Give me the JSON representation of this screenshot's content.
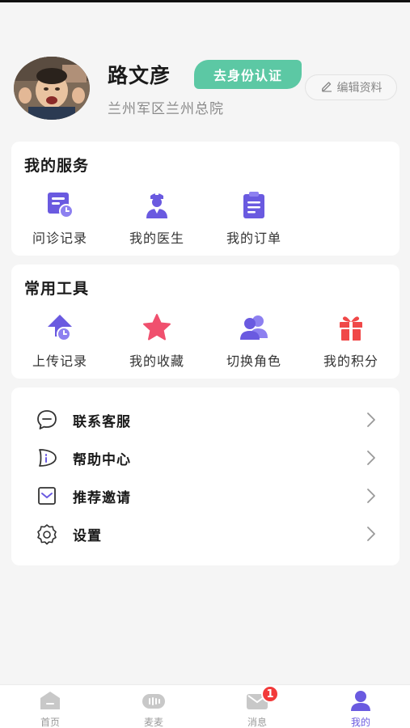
{
  "profile": {
    "name": "路文彦",
    "verify_label": "去身份认证",
    "edit_label": "编辑资料",
    "hospital": "兰州军区兰州总院"
  },
  "services": {
    "title": "我的服务",
    "items": [
      {
        "label": "问诊记录",
        "icon": "consult-record-icon"
      },
      {
        "label": "我的医生",
        "icon": "doctor-icon"
      },
      {
        "label": "我的订单",
        "icon": "order-clipboard-icon"
      }
    ]
  },
  "tools": {
    "title": "常用工具",
    "items": [
      {
        "label": "上传记录",
        "icon": "upload-icon"
      },
      {
        "label": "我的收藏",
        "icon": "star-icon"
      },
      {
        "label": "切换角色",
        "icon": "switch-role-icon"
      },
      {
        "label": "我的积分",
        "icon": "gift-icon"
      }
    ]
  },
  "menu": [
    {
      "label": "联系客服",
      "icon": "chat-icon"
    },
    {
      "label": "帮助中心",
      "icon": "help-icon"
    },
    {
      "label": "推荐邀请",
      "icon": "invite-icon"
    },
    {
      "label": "设置",
      "icon": "settings-icon"
    }
  ],
  "tabbar": {
    "items": [
      {
        "label": "首页",
        "icon": "home-icon"
      },
      {
        "label": "麦麦",
        "icon": "maimai-icon"
      },
      {
        "label": "消息",
        "icon": "message-icon",
        "badge": "1"
      },
      {
        "label": "我的",
        "icon": "user-icon",
        "active": true
      }
    ]
  },
  "colors": {
    "accent": "#6a5ae0",
    "verify": "#5cc8a4",
    "badge": "#f23a3a",
    "star": "#f0506e",
    "gift": "#f04848"
  }
}
